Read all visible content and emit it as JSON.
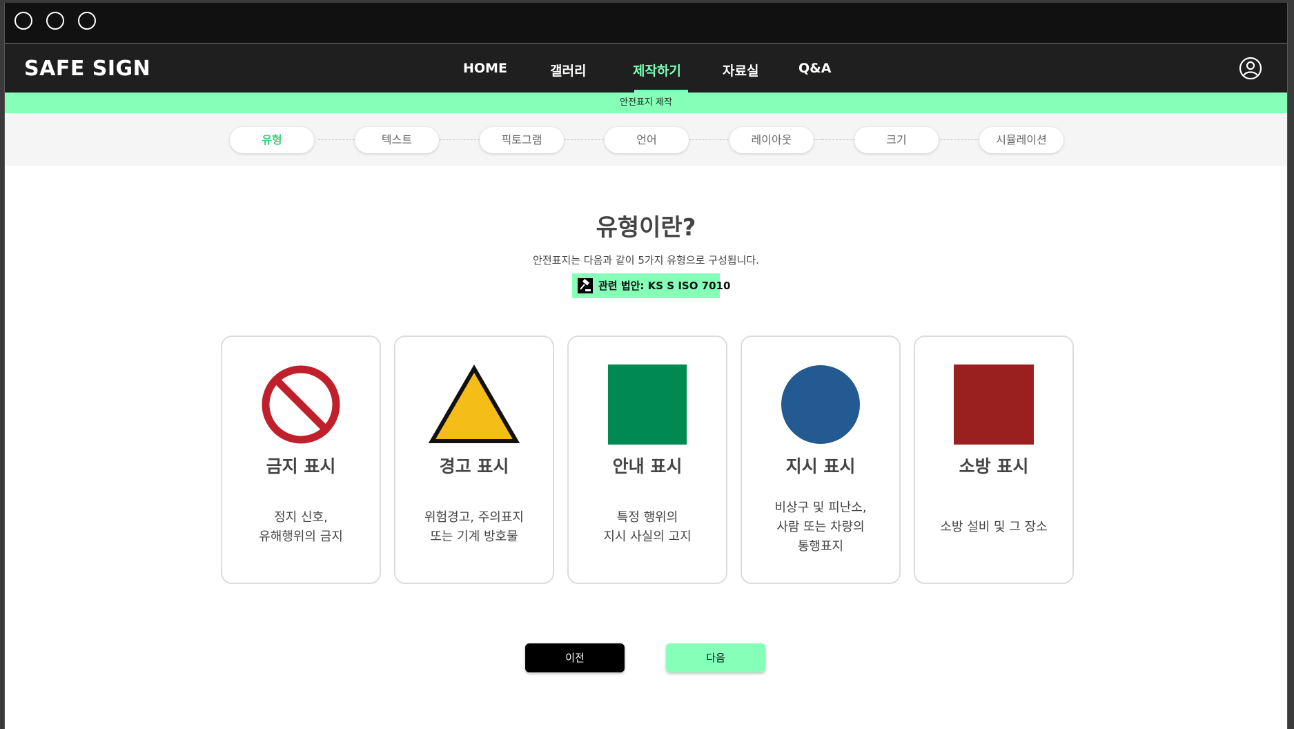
{
  "header": {
    "logo": "SAFE SIGN",
    "menu": [
      {
        "label": "HOME"
      },
      {
        "label": "갤러리"
      },
      {
        "label": "제작하기",
        "active": true
      },
      {
        "label": "자료실"
      },
      {
        "label": "Q&A"
      }
    ],
    "user_icon": "user-circle-icon"
  },
  "subbar": {
    "label": "안전표지 제작"
  },
  "steps": [
    {
      "label": "유형",
      "active": true
    },
    {
      "label": "텍스트"
    },
    {
      "label": "픽토그램"
    },
    {
      "label": "언어"
    },
    {
      "label": "레이아웃"
    },
    {
      "label": "크기"
    },
    {
      "label": "시뮬레이션"
    }
  ],
  "main": {
    "title": "유형이란?",
    "subtitle": "안전표지는 다음과 같이 5가지 유형으로 구성됩니다.",
    "law_icon": "gavel-icon",
    "law_label": "관련 법안: KS S ISO 7010"
  },
  "cards": [
    {
      "title": "금지 표시",
      "desc": "정지 신호,\n유해행위의 금지",
      "symbol": "prohibition-circle-icon",
      "color": "#c0202b"
    },
    {
      "title": "경고 표시",
      "desc": "위험경고, 주의표지\n또는 기계 방호물",
      "symbol": "warning-triangle-icon",
      "color": "#f5bd17"
    },
    {
      "title": "안내 표시",
      "desc": "특정 행위의\n지시  사실의 고지",
      "symbol": "green-square-icon",
      "color": "#008a52"
    },
    {
      "title": "지시 표시",
      "desc": "비상구 및 피난소,\n사람 또는 차량의\n통행표지",
      "symbol": "blue-circle-icon",
      "color": "#245a92"
    },
    {
      "title": "소방 표시",
      "desc": "소방 설비 및 그 장소",
      "symbol": "red-square-icon",
      "color": "#9a2020"
    }
  ],
  "buttons": {
    "prev": "이전",
    "next": "다음"
  },
  "colors": {
    "accent": "#86ffb8",
    "active_text": "#3fd37f",
    "nav_bg": "#1f1f1f"
  }
}
